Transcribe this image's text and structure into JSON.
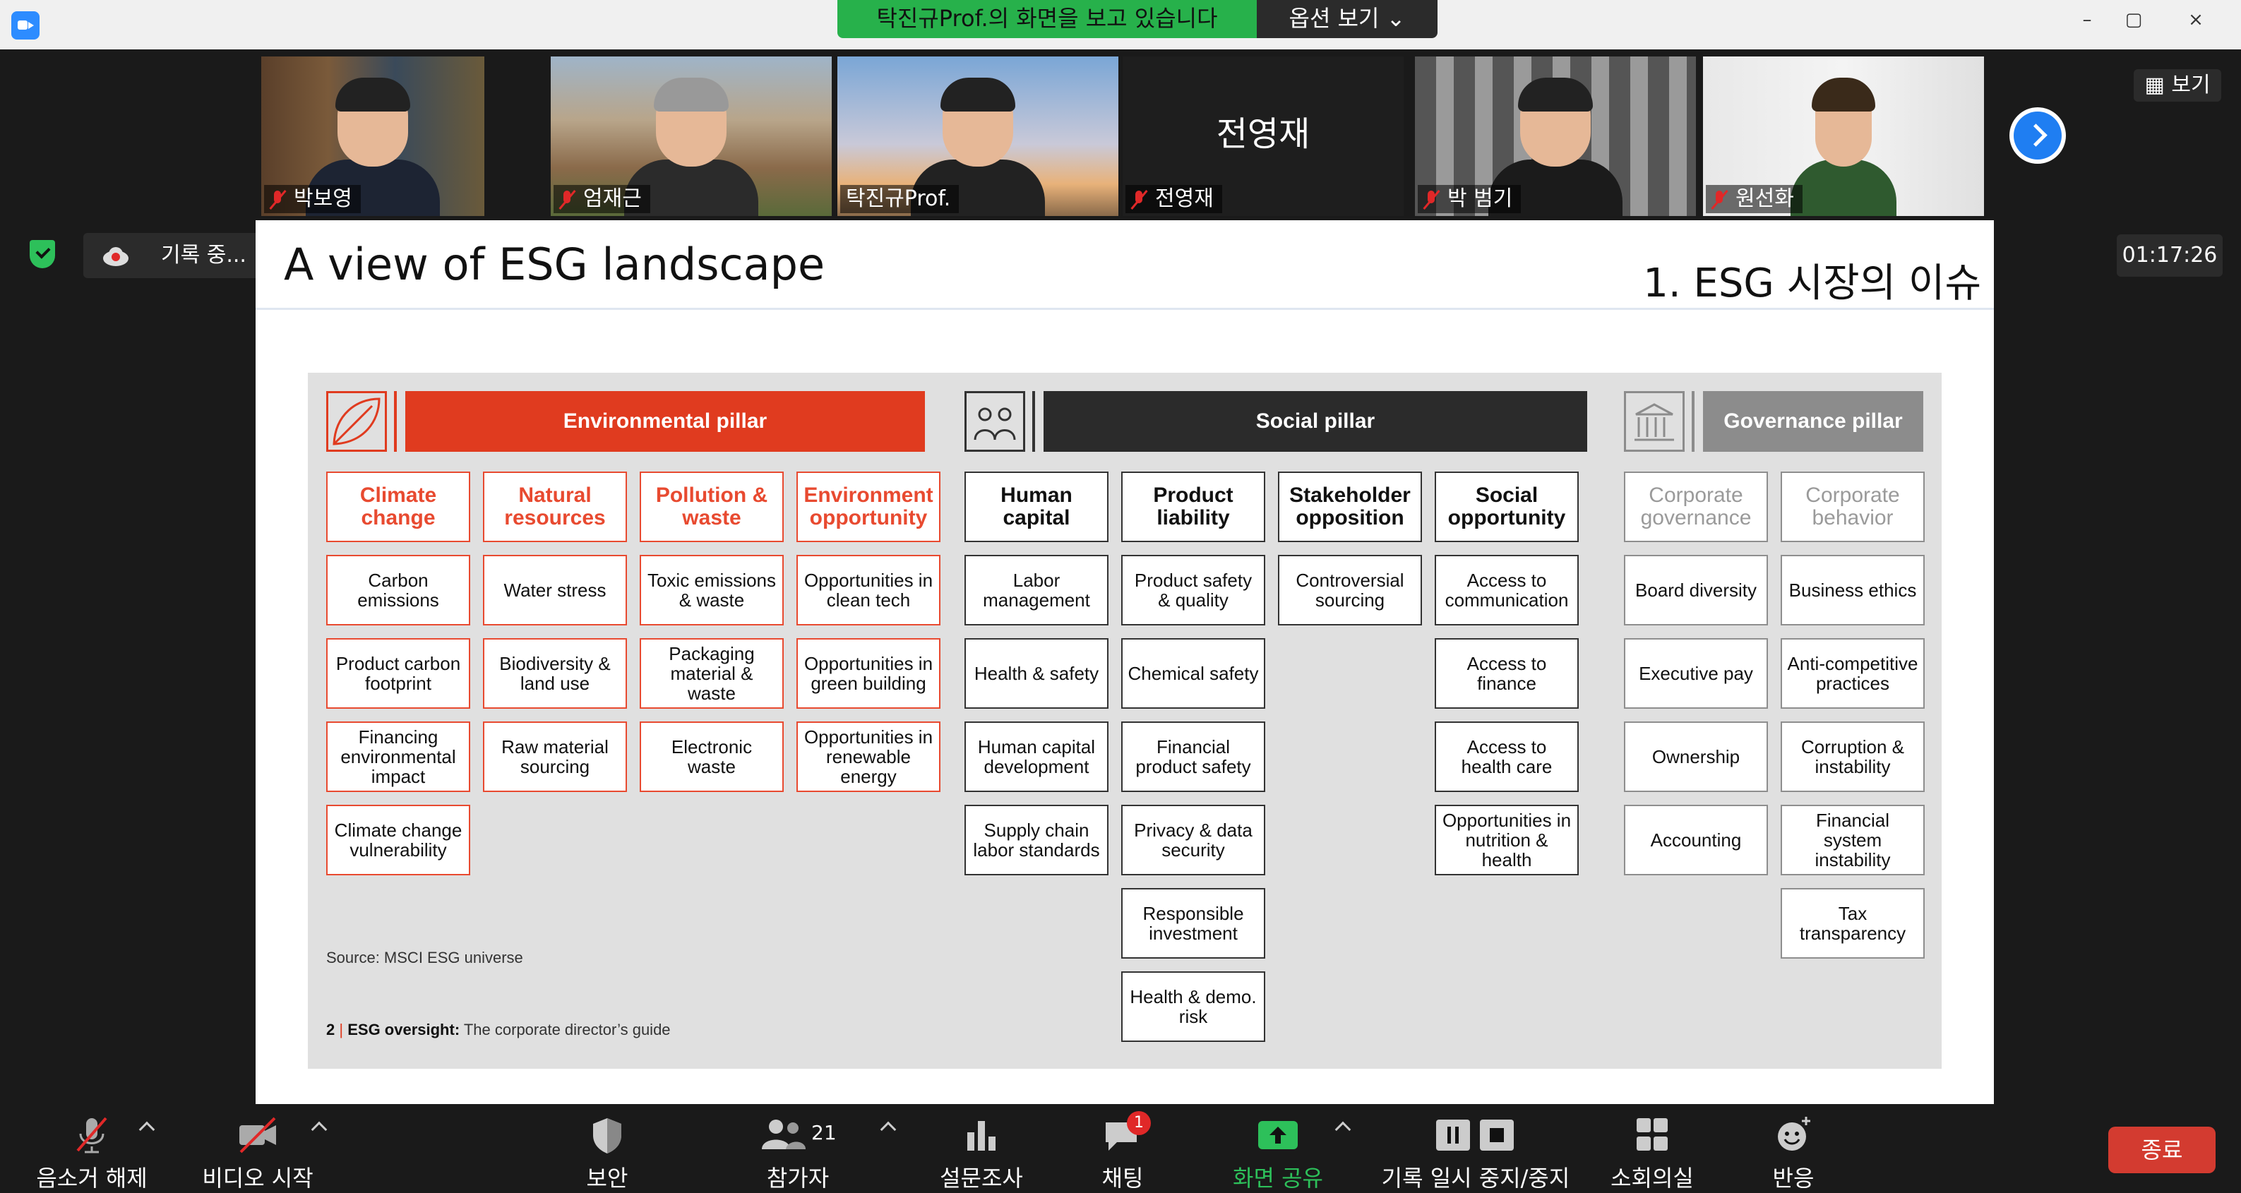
{
  "titlebar": {
    "minimize": "–",
    "maximize": "▢",
    "close": "×"
  },
  "share_banner": {
    "text": "탁진규Prof.의 화면을 보고 있습니다",
    "options": "옵션 보기 ⌄"
  },
  "participants": [
    {
      "name": "박보영",
      "muted": true
    },
    {
      "name": "엄재근",
      "muted": true
    },
    {
      "name": "탁진규Prof.",
      "muted": false
    },
    {
      "name": "전영재",
      "muted": true,
      "big_label": "전영재"
    },
    {
      "name": "박 범기",
      "muted": true
    },
    {
      "name": "원선화",
      "muted": true
    }
  ],
  "view_button": "보기",
  "recording": {
    "label": "기록 중..."
  },
  "timer": "01:17:26",
  "slide": {
    "title": "A view of ESG landscape",
    "subtitle": "1. ESG 시장의 이슈",
    "source": "Source: MSCI ESG universe",
    "footer_num": "2",
    "footer_bold": "ESG oversight:",
    "footer_rest": " The corporate director’s guide",
    "pillars": {
      "env": "Environmental pillar",
      "social": "Social pillar",
      "gov": "Governance pillar"
    },
    "env_cols": [
      {
        "head": "Climate change",
        "items": [
          "Carbon emissions",
          "Product carbon footprint",
          "Financing environmental impact",
          "Climate change vulnerability"
        ]
      },
      {
        "head": "Natural resources",
        "items": [
          "Water stress",
          "Biodiversity & land use",
          "Raw material sourcing"
        ]
      },
      {
        "head": "Pollution & waste",
        "items": [
          "Toxic emissions & waste",
          "Packaging material & waste",
          "Electronic waste"
        ]
      },
      {
        "head": "Environment opportunity",
        "items": [
          "Opportunities in clean tech",
          "Opportunities in green building",
          "Opportunities in renewable energy"
        ]
      }
    ],
    "social_cols": [
      {
        "head": "Human capital",
        "items": [
          "Labor management",
          "Health & safety",
          "Human capital development",
          "Supply chain labor standards"
        ]
      },
      {
        "head": "Product liability",
        "items": [
          "Product safety & quality",
          "Chemical safety",
          "Financial product safety",
          "Privacy & data security",
          "Responsible investment",
          "Health & demo. risk"
        ]
      },
      {
        "head": "Stakeholder opposition",
        "items": [
          "Controversial sourcing"
        ]
      },
      {
        "head": "Social opportunity",
        "items": [
          "Access to communication",
          "Access to finance",
          "Access to health care",
          "Opportunities in nutrition & health"
        ]
      }
    ],
    "gov_cols": [
      {
        "head": "Corporate governance",
        "items": [
          "Board diversity",
          "Executive pay",
          "Ownership",
          "Accounting"
        ]
      },
      {
        "head": "Corporate behavior",
        "items": [
          "Business ethics",
          "Anti-competitive practices",
          "Corruption & instability",
          "Financial system instability",
          "Tax transparency"
        ]
      }
    ]
  },
  "toolbar": {
    "mute": "음소거 해제",
    "video": "비디오 시작",
    "security": "보안",
    "participants": "참가자",
    "participants_count": "21",
    "polls": "설문조사",
    "chat": "채팅",
    "chat_badge": "1",
    "share": "화면 공유",
    "record": "기록 일시 중지/중지",
    "breakout": "소회의실",
    "reactions": "반응",
    "end": "종료"
  },
  "colors": {
    "accent_green": "#27b14b",
    "env_red": "#e03b1f",
    "social_dark": "#2b2b2b",
    "gov_gray": "#8c8c8c",
    "end_red": "#d33b30",
    "zoom_blue": "#2d8cff"
  }
}
